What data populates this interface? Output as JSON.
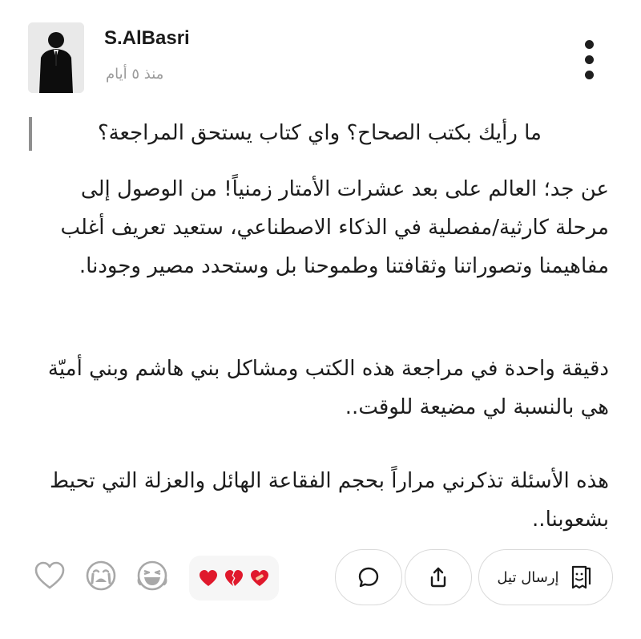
{
  "post": {
    "author": "S.AlBasri",
    "time_ago": "منذ ٥ أيام",
    "quote": "ما رأيك بكتب الصحاح؟  واي كتاب يستحق المراجعة؟",
    "paragraphs": [
      "عن جد؛ العالم على بعد عشرات الأمتار زمنياً! من الوصول إلى مرحلة كارثية/مفصلية في الذكاء الاصطناعي، ستعيد تعريف أغلب مفاهيمنا وتصوراتنا وثقافتنا وطموحنا بل وستحدد مصير وجودنا.",
      "دقيقة واحدة في مراجعة هذه الكتب ومشاكل بني هاشم وبني أميّة هي بالنسبة لي مضيعة للوقت..",
      "هذه الأسئلة تذكرني مراراً بحجم الفقاعة الهائل والعزلة التي تحيط بشعوبنا.."
    ]
  },
  "actions": {
    "send_label": "إرسال تيل",
    "icons": {
      "more": "more-vertical-icon",
      "like": "heart-outline-icon",
      "cry_reaction": "crying-face-icon",
      "laugh_reaction": "laughing-face-icon",
      "comment": "comment-bubble-icon",
      "share": "share-icon",
      "send": "receipt-note-icon"
    }
  },
  "colors": {
    "heart_red": "#e0192c",
    "text": "#1c1c1c",
    "muted": "#9a9a9a"
  }
}
